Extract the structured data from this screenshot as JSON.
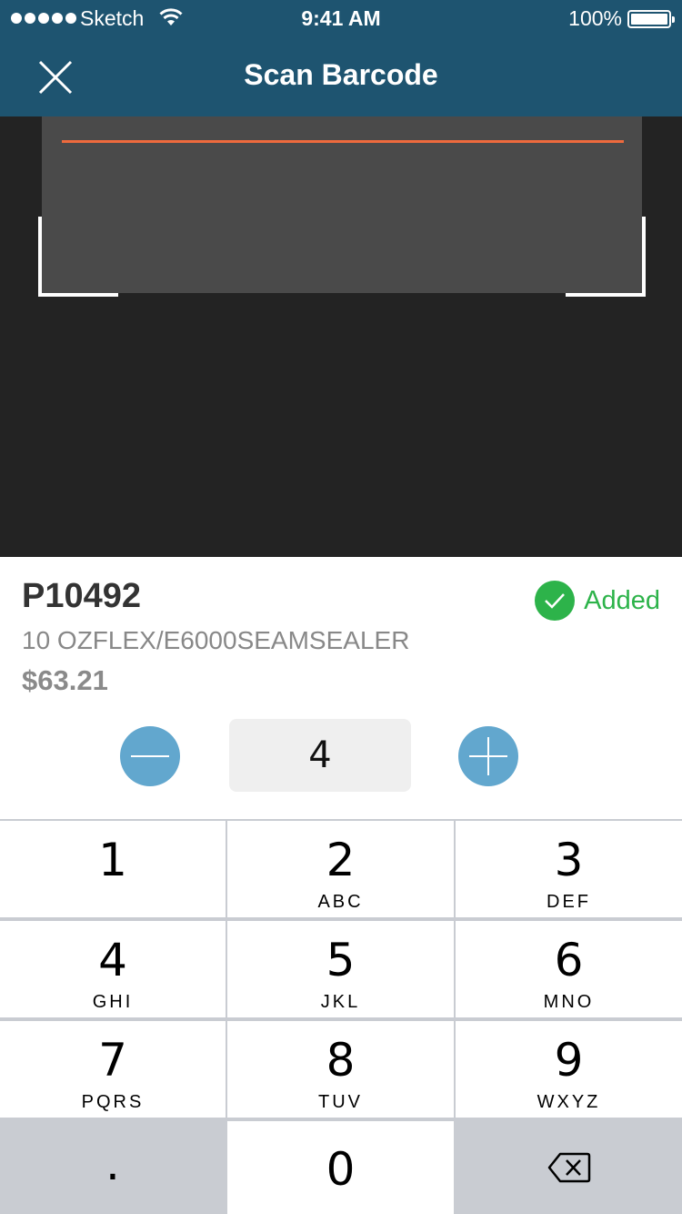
{
  "status_bar": {
    "carrier": "Sketch",
    "time": "9:41 AM",
    "battery": "100%"
  },
  "nav": {
    "title": "Scan Barcode"
  },
  "product": {
    "sku": "P10492",
    "description": "10 OZFLEX/E6000SEAMSEALER",
    "price": "$63.21",
    "status": "Added",
    "quantity": "4"
  },
  "keypad": {
    "keys": [
      {
        "num": "1",
        "letters": ""
      },
      {
        "num": "2",
        "letters": "ABC"
      },
      {
        "num": "3",
        "letters": "DEF"
      },
      {
        "num": "4",
        "letters": "GHI"
      },
      {
        "num": "5",
        "letters": "JKL"
      },
      {
        "num": "6",
        "letters": "MNO"
      },
      {
        "num": "7",
        "letters": "PQRS"
      },
      {
        "num": "8",
        "letters": "TUV"
      },
      {
        "num": "9",
        "letters": "WXYZ"
      },
      {
        "num": ".",
        "letters": ""
      },
      {
        "num": "0",
        "letters": ""
      },
      {
        "num": "",
        "letters": "",
        "icon": "backspace-icon"
      }
    ]
  },
  "colors": {
    "nav": "#1e5470",
    "accent": "#62a7ce",
    "success": "#2db34a",
    "scan_line": "#ee6a3d"
  }
}
